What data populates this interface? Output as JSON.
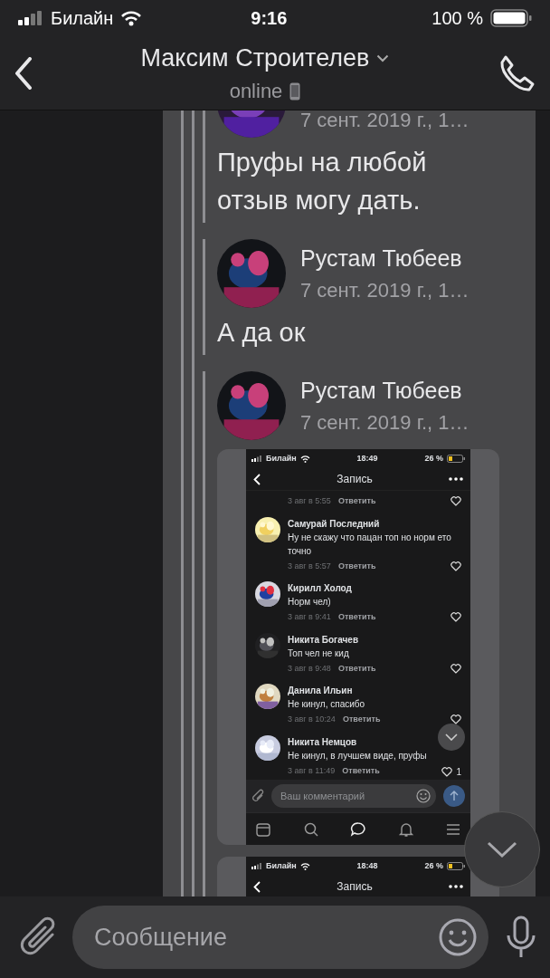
{
  "status_bar": {
    "carrier": "Билайн",
    "time": "9:16",
    "battery": "100 %"
  },
  "header": {
    "title": "Максим Строителев",
    "status": "online"
  },
  "messages": [
    {
      "date": "7 сент. 2019 г., 1…",
      "text": "Пруфы на любой отзыв могу дать."
    },
    {
      "author": "Рустам Тюбеев",
      "date": "7 сент. 2019 г., 1…",
      "text": "А да ок"
    },
    {
      "author": "Рустам Тюбеев",
      "date": "7 сент. 2019 г., 1…",
      "screenshots": [
        {
          "status_bar": {
            "carrier": "Билайн",
            "time": "18:49",
            "battery": "26 %"
          },
          "title": "Запись",
          "comments": [
            {
              "date": "3 авг в 5:55",
              "reply": "Ответить"
            },
            {
              "author": "Самурай Последний",
              "text": "Ну не скажу что пацан топ но норм ето точно",
              "date": "3 авг в 5:57",
              "reply": "Ответить"
            },
            {
              "author": "Кирилл Холод",
              "text": "Норм чел)",
              "date": "3 авг в 9:41",
              "reply": "Ответить"
            },
            {
              "author": "Никита Богачев",
              "text": "Топ чел не кид",
              "date": "3 авг в 9:48",
              "reply": "Ответить"
            },
            {
              "author": "Данила Ильин",
              "text": "Не кинул, спасибо",
              "date": "3 авг в 10:24",
              "reply": "Ответить"
            },
            {
              "author": "Никита Немцов",
              "text": "Не кинул, в лучшем виде, пруфы",
              "date": "3 авг в 11:49",
              "reply": "Ответить",
              "likes": "1"
            }
          ],
          "comment_field": {
            "placeholder": "Ваш комментарий"
          }
        },
        {
          "status_bar": {
            "carrier": "Билайн",
            "time": "18:48",
            "battery": "26 %"
          },
          "title": "Запись"
        }
      ]
    }
  ],
  "composer": {
    "placeholder": "Сообщение"
  }
}
